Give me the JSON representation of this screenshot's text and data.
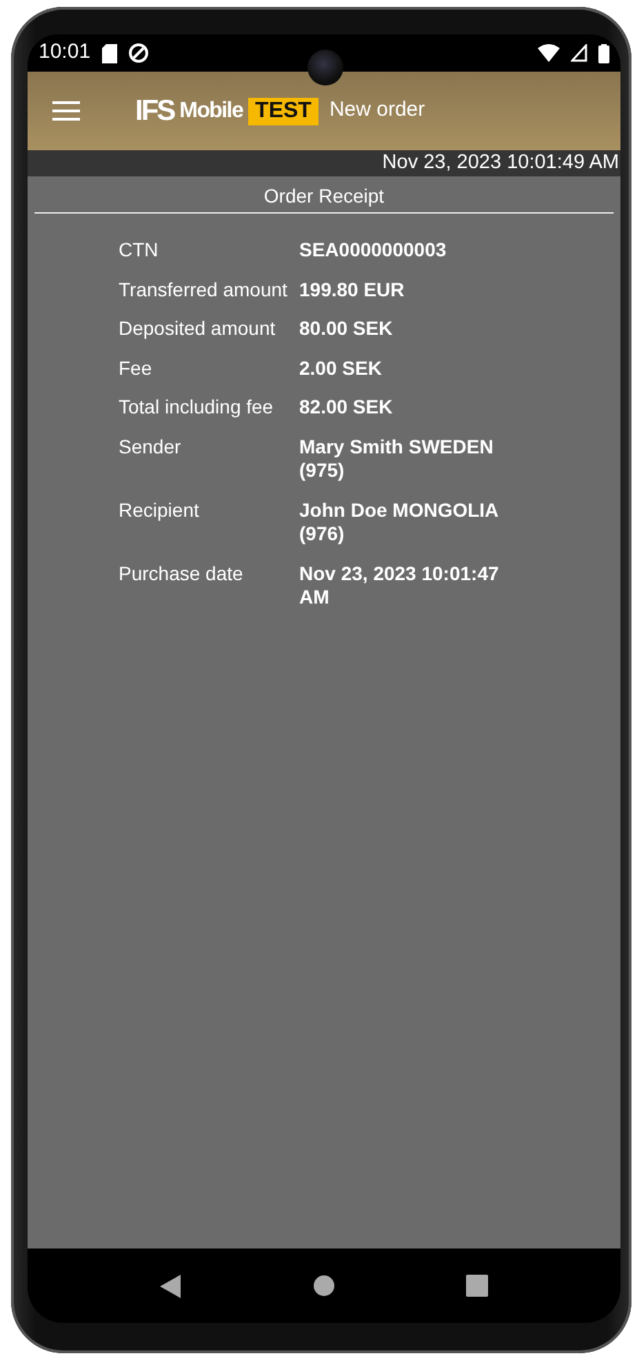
{
  "status_bar": {
    "time": "10:01"
  },
  "app_bar": {
    "logo": {
      "brand": "IFS",
      "product": "Mobile",
      "environment": "TEST"
    },
    "title": "New order"
  },
  "timestamp": "Nov 23, 2023 10:01:49 AM",
  "section_title": "Order Receipt",
  "fields": [
    {
      "label": "CTN",
      "value": "SEA0000000003"
    },
    {
      "label": "Transferred amount",
      "value": "199.80 EUR"
    },
    {
      "label": "Deposited amount",
      "value": "80.00 SEK"
    },
    {
      "label": "Fee",
      "value": "2.00 SEK"
    },
    {
      "label": "Total including fee",
      "value": "82.00 SEK"
    },
    {
      "label": "Sender",
      "value": "Mary Smith SWEDEN (975)"
    },
    {
      "label": "Recipient",
      "value": "John Doe MONGOLIA (976)"
    },
    {
      "label": "Purchase date",
      "value": "Nov 23, 2023 10:01:47 AM"
    }
  ]
}
